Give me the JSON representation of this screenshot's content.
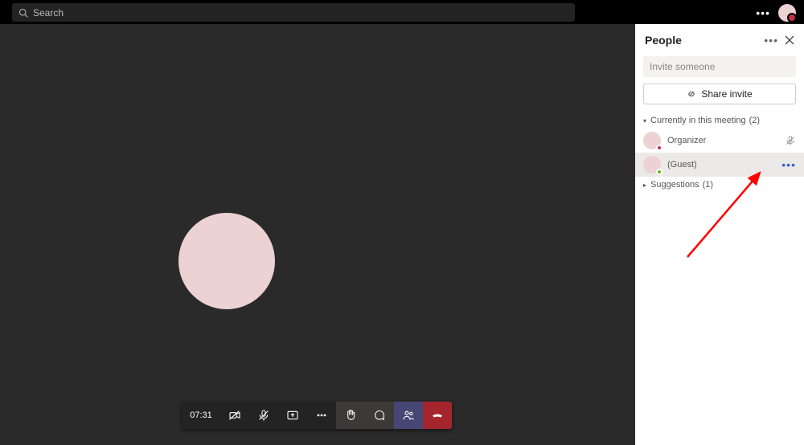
{
  "topbar": {
    "search_placeholder": "Search"
  },
  "call": {
    "timer": "07:31"
  },
  "panel": {
    "title": "People",
    "invite_placeholder": "Invite someone",
    "share_label": "Share invite",
    "sections": {
      "current": {
        "label": "Currently in this meeting",
        "count": "(2)"
      },
      "suggestions": {
        "label": "Suggestions",
        "count": "(1)"
      }
    },
    "participants": [
      {
        "label": "Organizer",
        "presence": "busy",
        "muted": true
      },
      {
        "label": "(Guest)",
        "presence": "avail",
        "more": true
      }
    ]
  },
  "colors": {
    "avatar": "#ecd2d2",
    "hangup": "#a4262c",
    "people_active": "#464775"
  }
}
